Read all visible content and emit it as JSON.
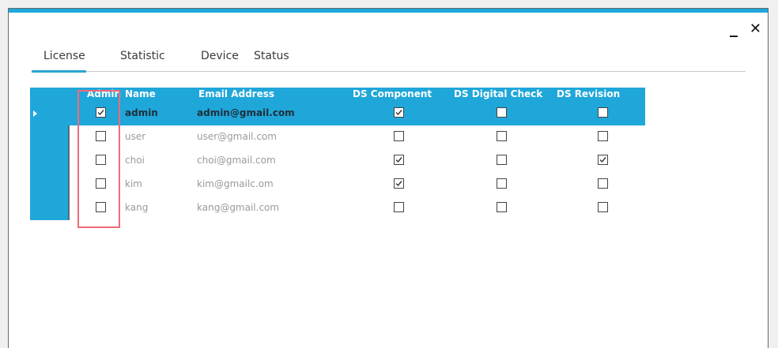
{
  "window": {
    "minimize_label": "_",
    "close_label": "✕"
  },
  "tabs": [
    {
      "label": "License"
    },
    {
      "label": "Statistic"
    },
    {
      "label": "Device"
    },
    {
      "label": "Status"
    }
  ],
  "grid": {
    "columns": [
      "Admin",
      "Name",
      "Email Address",
      "DS Component",
      "DS Digital Check",
      "DS Revision"
    ],
    "rows": [
      {
        "admin": true,
        "name": "admin",
        "email": "admin@gmail.com",
        "ds_component": true,
        "ds_digital_check": false,
        "ds_revision": false,
        "selected": true
      },
      {
        "admin": false,
        "name": "user",
        "email": "user@gmail.com",
        "ds_component": false,
        "ds_digital_check": false,
        "ds_revision": false,
        "selected": false
      },
      {
        "admin": false,
        "name": "choi",
        "email": "choi@gmail.com",
        "ds_component": true,
        "ds_digital_check": false,
        "ds_revision": true,
        "selected": false
      },
      {
        "admin": false,
        "name": "kim",
        "email": "kim@gmailc.om",
        "ds_component": true,
        "ds_digital_check": false,
        "ds_revision": false,
        "selected": false
      },
      {
        "admin": false,
        "name": "kang",
        "email": "kang@gmail.com",
        "ds_component": false,
        "ds_digital_check": false,
        "ds_revision": false,
        "selected": false
      }
    ]
  },
  "colors": {
    "accent": "#1fa7da",
    "highlight": "#f06b7a"
  }
}
